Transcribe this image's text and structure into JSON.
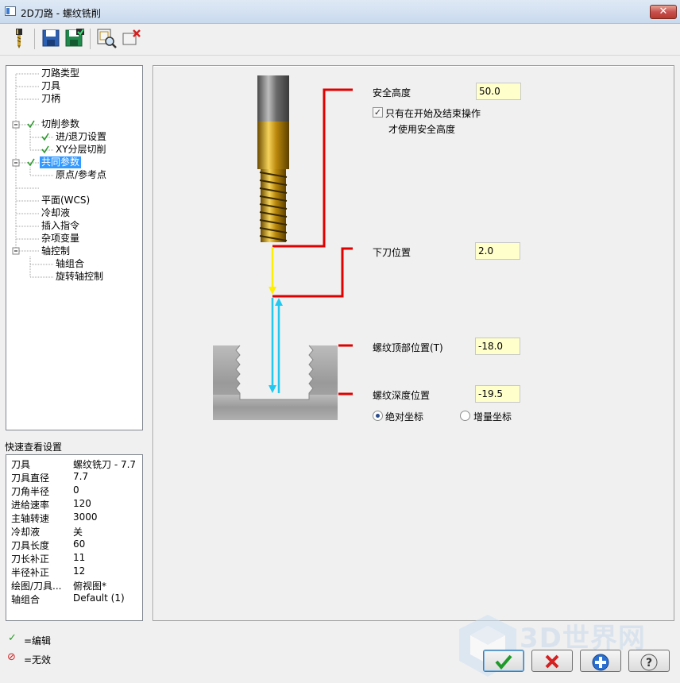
{
  "window": {
    "title": "2D刀路 - 螺纹铣削",
    "close_label": "✕"
  },
  "toolbar": {
    "items": [
      {
        "name": "tool-icon"
      },
      {
        "name": "save-icon"
      },
      {
        "name": "save-as-icon"
      },
      {
        "name": "preview-icon"
      },
      {
        "name": "delete-icon"
      }
    ]
  },
  "tree": {
    "items": [
      {
        "label": "刀路类型"
      },
      {
        "label": "刀具"
      },
      {
        "label": "刀柄"
      },
      {
        "label": "切削参数"
      },
      {
        "label": "进/退刀设置"
      },
      {
        "label": "XY分层切削"
      },
      {
        "label": "共同参数"
      },
      {
        "label": "原点/参考点"
      },
      {
        "label": "平面(WCS)"
      },
      {
        "label": "冷却液"
      },
      {
        "label": "插入指令"
      },
      {
        "label": "杂项变量"
      },
      {
        "label": "轴控制"
      },
      {
        "label": "轴组合"
      },
      {
        "label": "旋转轴控制"
      }
    ]
  },
  "quick_view": {
    "title": "快速查看设置",
    "rows": [
      {
        "label": "刀具",
        "value": "螺纹铣刀 - 7.7"
      },
      {
        "label": "刀具直径",
        "value": "7.7"
      },
      {
        "label": "刀角半径",
        "value": "0"
      },
      {
        "label": "进给速率",
        "value": "120"
      },
      {
        "label": "主轴转速",
        "value": "3000"
      },
      {
        "label": "冷却液",
        "value": "关"
      },
      {
        "label": "刀具长度",
        "value": "60"
      },
      {
        "label": "刀长补正",
        "value": "11"
      },
      {
        "label": "半径补正",
        "value": "12"
      },
      {
        "label": "绘图/刀具...",
        "value": "俯视图*"
      },
      {
        "label": "轴组合",
        "value": "Default (1)"
      }
    ]
  },
  "params": {
    "safe_height_label": "安全高度",
    "safe_height_value": "50.0",
    "only_start_end_line1": "只有在开始及结束操作",
    "only_start_end_line2": "才使用安全高度",
    "only_start_end_checked": true,
    "feed_plane_label": "下刀位置",
    "feed_plane_value": "2.0",
    "thread_top_label": "螺纹顶部位置(T)",
    "thread_top_value": "-18.0",
    "thread_depth_label": "螺纹深度位置",
    "thread_depth_value": "-19.5",
    "absolute_label": "绝对坐标",
    "incremental_label": "增量坐标",
    "mode": "absolute"
  },
  "legend": {
    "edited": "=编辑",
    "disabled": "=无效"
  },
  "colors": {
    "leader_red": "#e00000",
    "arrow_yellow": "#ffee00",
    "arrow_cyan": "#22c8f0",
    "selected_bg": "#3399ff",
    "field_bg": "#ffffcc",
    "tool_gold": "#d4a017"
  },
  "watermark": {
    "text": "3D世界网"
  }
}
